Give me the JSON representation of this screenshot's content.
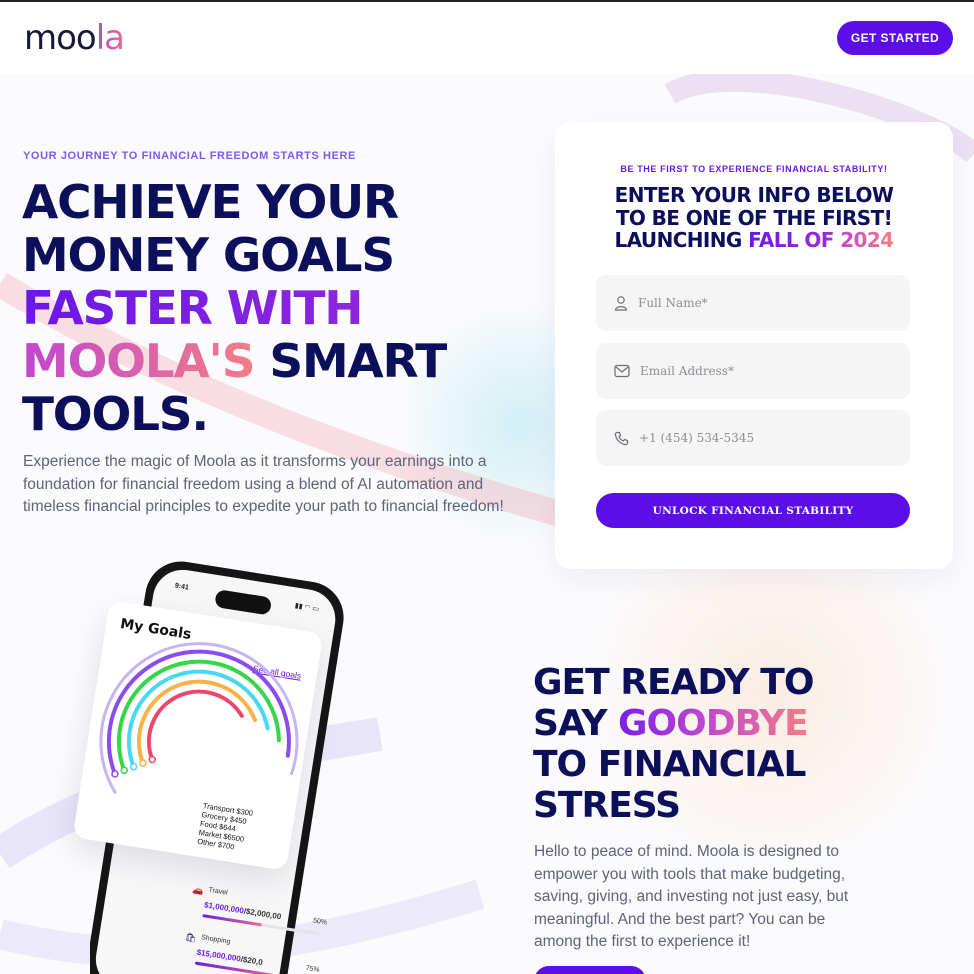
{
  "header": {
    "logo_main": "moo",
    "logo_accent": "la",
    "cta_label": "GET STARTED"
  },
  "hero": {
    "eyebrow": "YOUR JOURNEY TO FINANCIAL FREEDOM STARTS HERE",
    "title_line1": "ACHIEVE YOUR",
    "title_line2": "MONEY GOALS",
    "title_line3": "FASTER WITH",
    "title_line4_accent": "MOOLA'S",
    "title_line4_rest": " SMART",
    "title_line5": "TOOLS.",
    "description": "Experience the magic of Moola as it transforms your earnings into a foundation for financial freedom using a blend of AI automation and timeless financial principles to expedite your path to financial freedom!"
  },
  "signup": {
    "eyebrow": "BE THE FIRST TO EXPERIENCE FINANCIAL STABILITY!",
    "title_line1": "ENTER YOUR INFO BELOW",
    "title_line2": "TO BE ONE OF THE FIRST!",
    "title_line3_prefix": "LAUNCHING ",
    "title_line3_accent1": "FALL OF ",
    "title_line3_accent2": "2024",
    "full_name_placeholder": "Full Name*",
    "email_placeholder": "Email Address*",
    "phone_placeholder": "+1 (454) 534-5345",
    "submit_label": "UNLOCK FINANCIAL STABILITY"
  },
  "phone": {
    "time": "9:41",
    "status": "▮▮ ◠ ▭",
    "goals_title": "My Goals",
    "see_all": "See all goals",
    "legend": [
      "Transport $300",
      "Grocery $450",
      "Food $644",
      "Market $6500",
      "Other $700"
    ],
    "ring_colors": [
      "#f0456b",
      "#f7b247",
      "#47d9f0",
      "#37d64a",
      "#8a4cf0",
      "#c9b3f5"
    ],
    "items": [
      {
        "name": "Travel",
        "value": "$1,000,000",
        "total": "/$2,000,00",
        "pct": "50%",
        "progress": 0.5,
        "icon": "🚗"
      },
      {
        "name": "Shopping",
        "value": "$15,000,000",
        "total": "/$20,0",
        "pct": "75%",
        "progress": 0.75,
        "icon": "🛍"
      }
    ]
  },
  "section2": {
    "title_line1": "GET READY TO",
    "title_line2_prefix": "SAY ",
    "title_line2_accent": "GOODBYE",
    "title_line3": "TO FINANCIAL",
    "title_line4": "STRESS",
    "description": "Hello to peace of mind. Moola is designed to empower you with tools that make budgeting, saving, giving, and investing not just easy, but meaningful. And the best part? You can be among the first to experience it!"
  }
}
